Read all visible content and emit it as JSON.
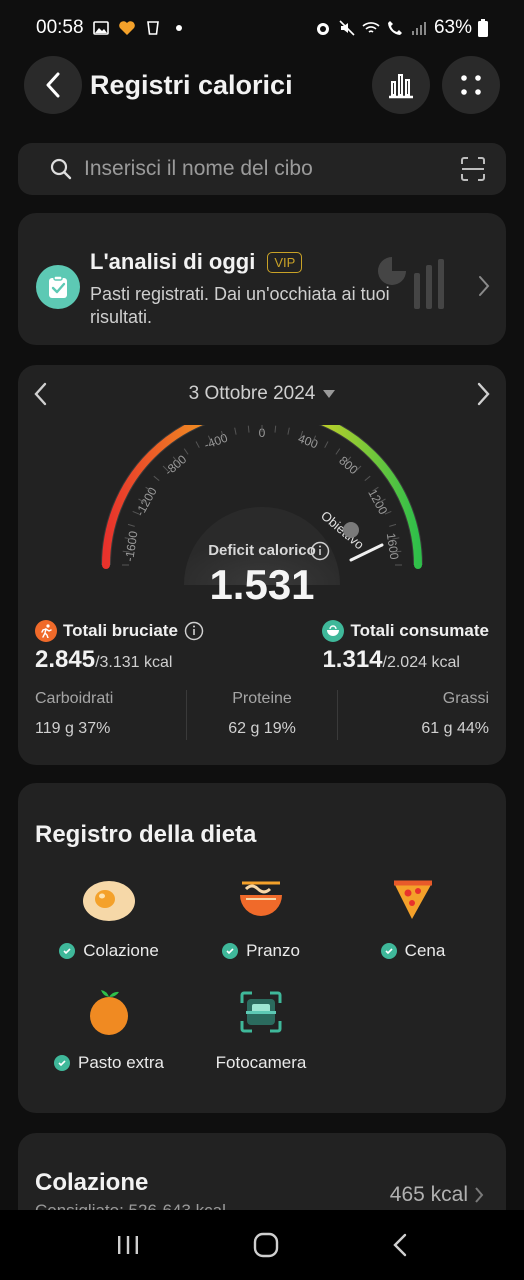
{
  "status": {
    "time": "00:58",
    "battery": "63%"
  },
  "header": {
    "title": "Registri calorici"
  },
  "search": {
    "placeholder": "Inserisci il nome del cibo"
  },
  "analysis": {
    "title": "L'analisi di oggi",
    "badge": "VIP",
    "description": "Pasti registrati. Dai un'occhiata ai tuoi risultati."
  },
  "calories": {
    "date": "3 Ottobre 2024",
    "gauge_ticks": [
      "-1600",
      "-1200",
      "-800",
      "-400",
      "0",
      "400",
      "800",
      "1200",
      "1600"
    ],
    "goal_label": "Obiettivo",
    "deficit_label": "Deficit calorico",
    "deficit_value": "1.531",
    "burned": {
      "label": "Totali bruciate",
      "value": "2.845",
      "target": "/3.131 kcal"
    },
    "consumed": {
      "label": "Totali consumate",
      "value": "1.314",
      "target": "/2.024 kcal"
    },
    "macros": [
      {
        "name": "Carboidrati",
        "value": "119 g  37%"
      },
      {
        "name": "Proteine",
        "value": "62 g  19%"
      },
      {
        "name": "Grassi",
        "value": "61 g  44%"
      }
    ]
  },
  "diet": {
    "title": "Registro della dieta",
    "items": [
      {
        "label": "Colazione",
        "icon": "fried-egg-icon",
        "checked": true
      },
      {
        "label": "Pranzo",
        "icon": "noodle-bowl-icon",
        "checked": true
      },
      {
        "label": "Cena",
        "icon": "pizza-slice-icon",
        "checked": true
      },
      {
        "label": "Pasto extra",
        "icon": "orange-icon",
        "checked": true
      },
      {
        "label": "Fotocamera",
        "icon": "camera-scan-icon",
        "checked": false
      }
    ]
  },
  "breakfast": {
    "title": "Colazione",
    "subtitle": "Consigliato: 526-643 kcal",
    "kcal": "465 kcal"
  },
  "colors": {
    "accent": "#5dc9b4",
    "check": "#3fb89a",
    "burned": "#f06a2a",
    "vip": "#c9a227"
  }
}
